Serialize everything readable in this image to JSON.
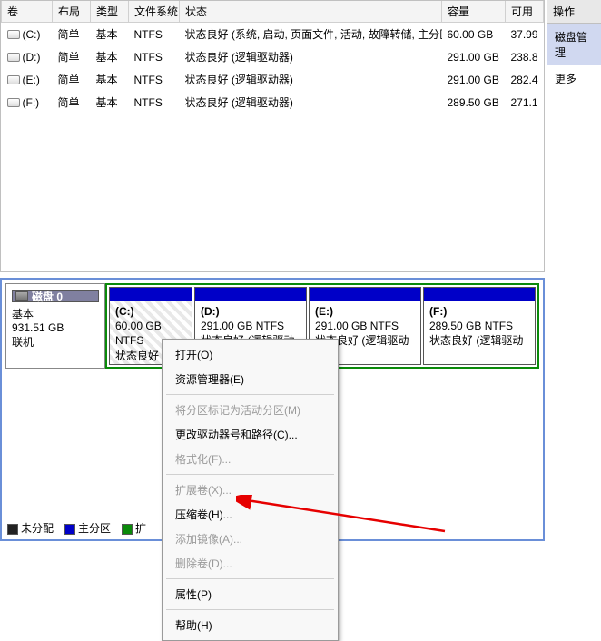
{
  "columns": {
    "vol": "卷",
    "layout": "布局",
    "type": "类型",
    "fs": "文件系统",
    "status": "状态",
    "capacity": "容量",
    "free": "可用"
  },
  "rows": [
    {
      "vol": "(C:)",
      "layout": "简单",
      "type": "基本",
      "fs": "NTFS",
      "status": "状态良好 (系统, 启动, 页面文件, 活动, 故障转储, 主分区)",
      "capacity": "60.00 GB",
      "free": "37.99"
    },
    {
      "vol": "(D:)",
      "layout": "简单",
      "type": "基本",
      "fs": "NTFS",
      "status": "状态良好 (逻辑驱动器)",
      "capacity": "291.00 GB",
      "free": "238.8"
    },
    {
      "vol": "(E:)",
      "layout": "简单",
      "type": "基本",
      "fs": "NTFS",
      "status": "状态良好 (逻辑驱动器)",
      "capacity": "291.00 GB",
      "free": "282.4"
    },
    {
      "vol": "(F:)",
      "layout": "简单",
      "type": "基本",
      "fs": "NTFS",
      "status": "状态良好 (逻辑驱动器)",
      "capacity": "289.50 GB",
      "free": "271.1"
    }
  ],
  "disk": {
    "title": "磁盘 0",
    "kind": "基本",
    "size": "931.51 GB",
    "state": "联机"
  },
  "parts": {
    "c": {
      "letter": "(C:)",
      "size": "60.00 GB NTFS",
      "status": "状态良好 (系统"
    },
    "d": {
      "letter": "(D:)",
      "size": "291.00 GB NTFS",
      "status": "状态良好 (逻辑驱动"
    },
    "e": {
      "letter": "(E:)",
      "size": "291.00 GB NTFS",
      "status": "状态良好 (逻辑驱动"
    },
    "f": {
      "letter": "(F:)",
      "size": "289.50 GB NTFS",
      "status": "状态良好 (逻辑驱动"
    }
  },
  "legend": {
    "unalloc": "未分配",
    "primary": "主分区",
    "ext": "扩"
  },
  "side": {
    "header": "操作",
    "item1": "磁盘管理",
    "item2": "更多"
  },
  "menu": {
    "open": "打开(O)",
    "explorer": "资源管理器(E)",
    "markactive": "将分区标记为活动分区(M)",
    "changeletter": "更改驱动器号和路径(C)...",
    "format": "格式化(F)...",
    "extend": "扩展卷(X)...",
    "shrink": "压缩卷(H)...",
    "mirror": "添加镜像(A)...",
    "delete": "删除卷(D)...",
    "props": "属性(P)",
    "help": "帮助(H)"
  }
}
